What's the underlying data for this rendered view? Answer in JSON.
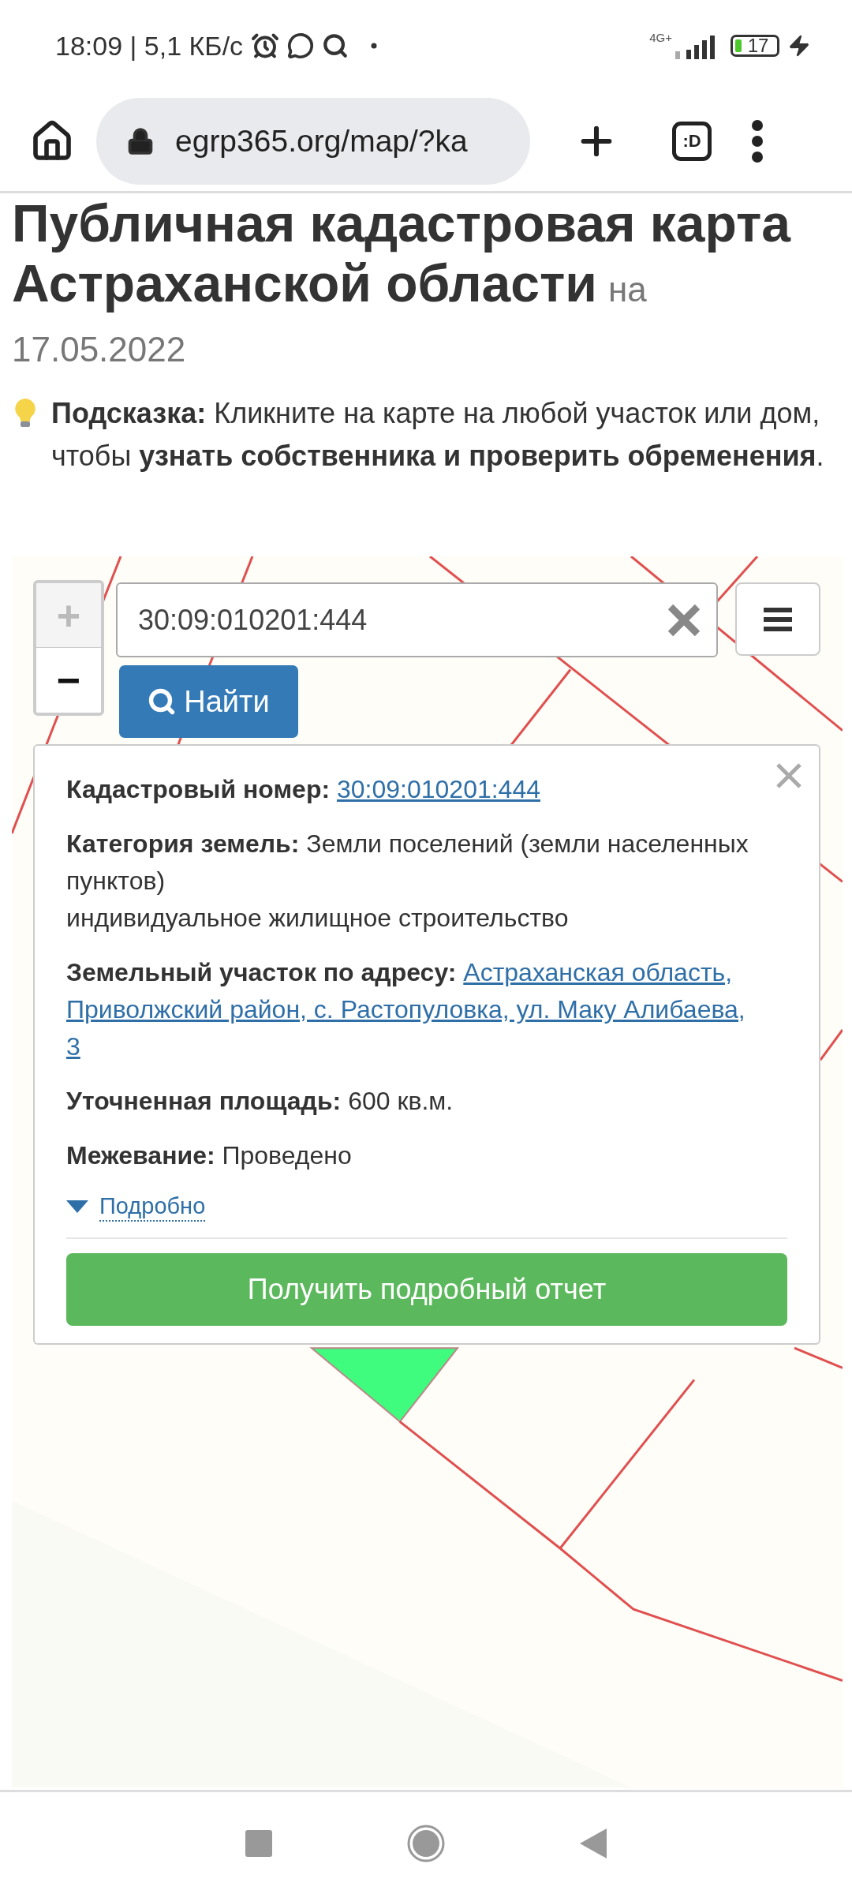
{
  "status_bar": {
    "time_speed": "18:09 | 5,1 КБ/с",
    "network": "4G+",
    "battery": "17"
  },
  "browser": {
    "url": "egrp365.org/map/?ka",
    "tabs_label": ":D"
  },
  "page": {
    "title": [
      "Публичная кадастровая карта",
      "Астраханской области"
    ],
    "date_prefix": "на",
    "date": "17.05.2022",
    "hint": "**Подсказка:** Кликните на карте на любой участок или дом, чтобы **узнать собственника и проверить обременения**."
  },
  "map": {
    "kind": "picture",
    "zoom": [
      {
        "label": "+",
        "disabled": true
      },
      {
        "label": "−",
        "disabled": false
      }
    ],
    "search": {
      "value": "30:09:010201:444"
    },
    "find_button": "Найти",
    "popup": {
      "rows": [
        {
          "kind": "link",
          "label": "Кадастровый номер:",
          "lines": [
            "30:09:010201:444"
          ]
        },
        {
          "kind": "text",
          "text": "**Категория земель:** Земли поселений (земли населенных пунктов)",
          "note": "индивидуальное жилищное строительство"
        },
        {
          "kind": "link",
          "label": "Земельный участок по адресу:",
          "lines": [
            "Астраханская область,",
            "Приволжский район, с. Растопуловка, ул. Маку Алибаева,",
            "3"
          ]
        },
        {
          "kind": "text",
          "text": "**Уточненная площадь:** 600 кв.м."
        },
        {
          "kind": "text",
          "text": "**Межевание:** Проведено"
        }
      ],
      "details": {
        "label": "Подробно",
        "expanded": false
      },
      "report_button": "Получить подробный отчет"
    }
  }
}
